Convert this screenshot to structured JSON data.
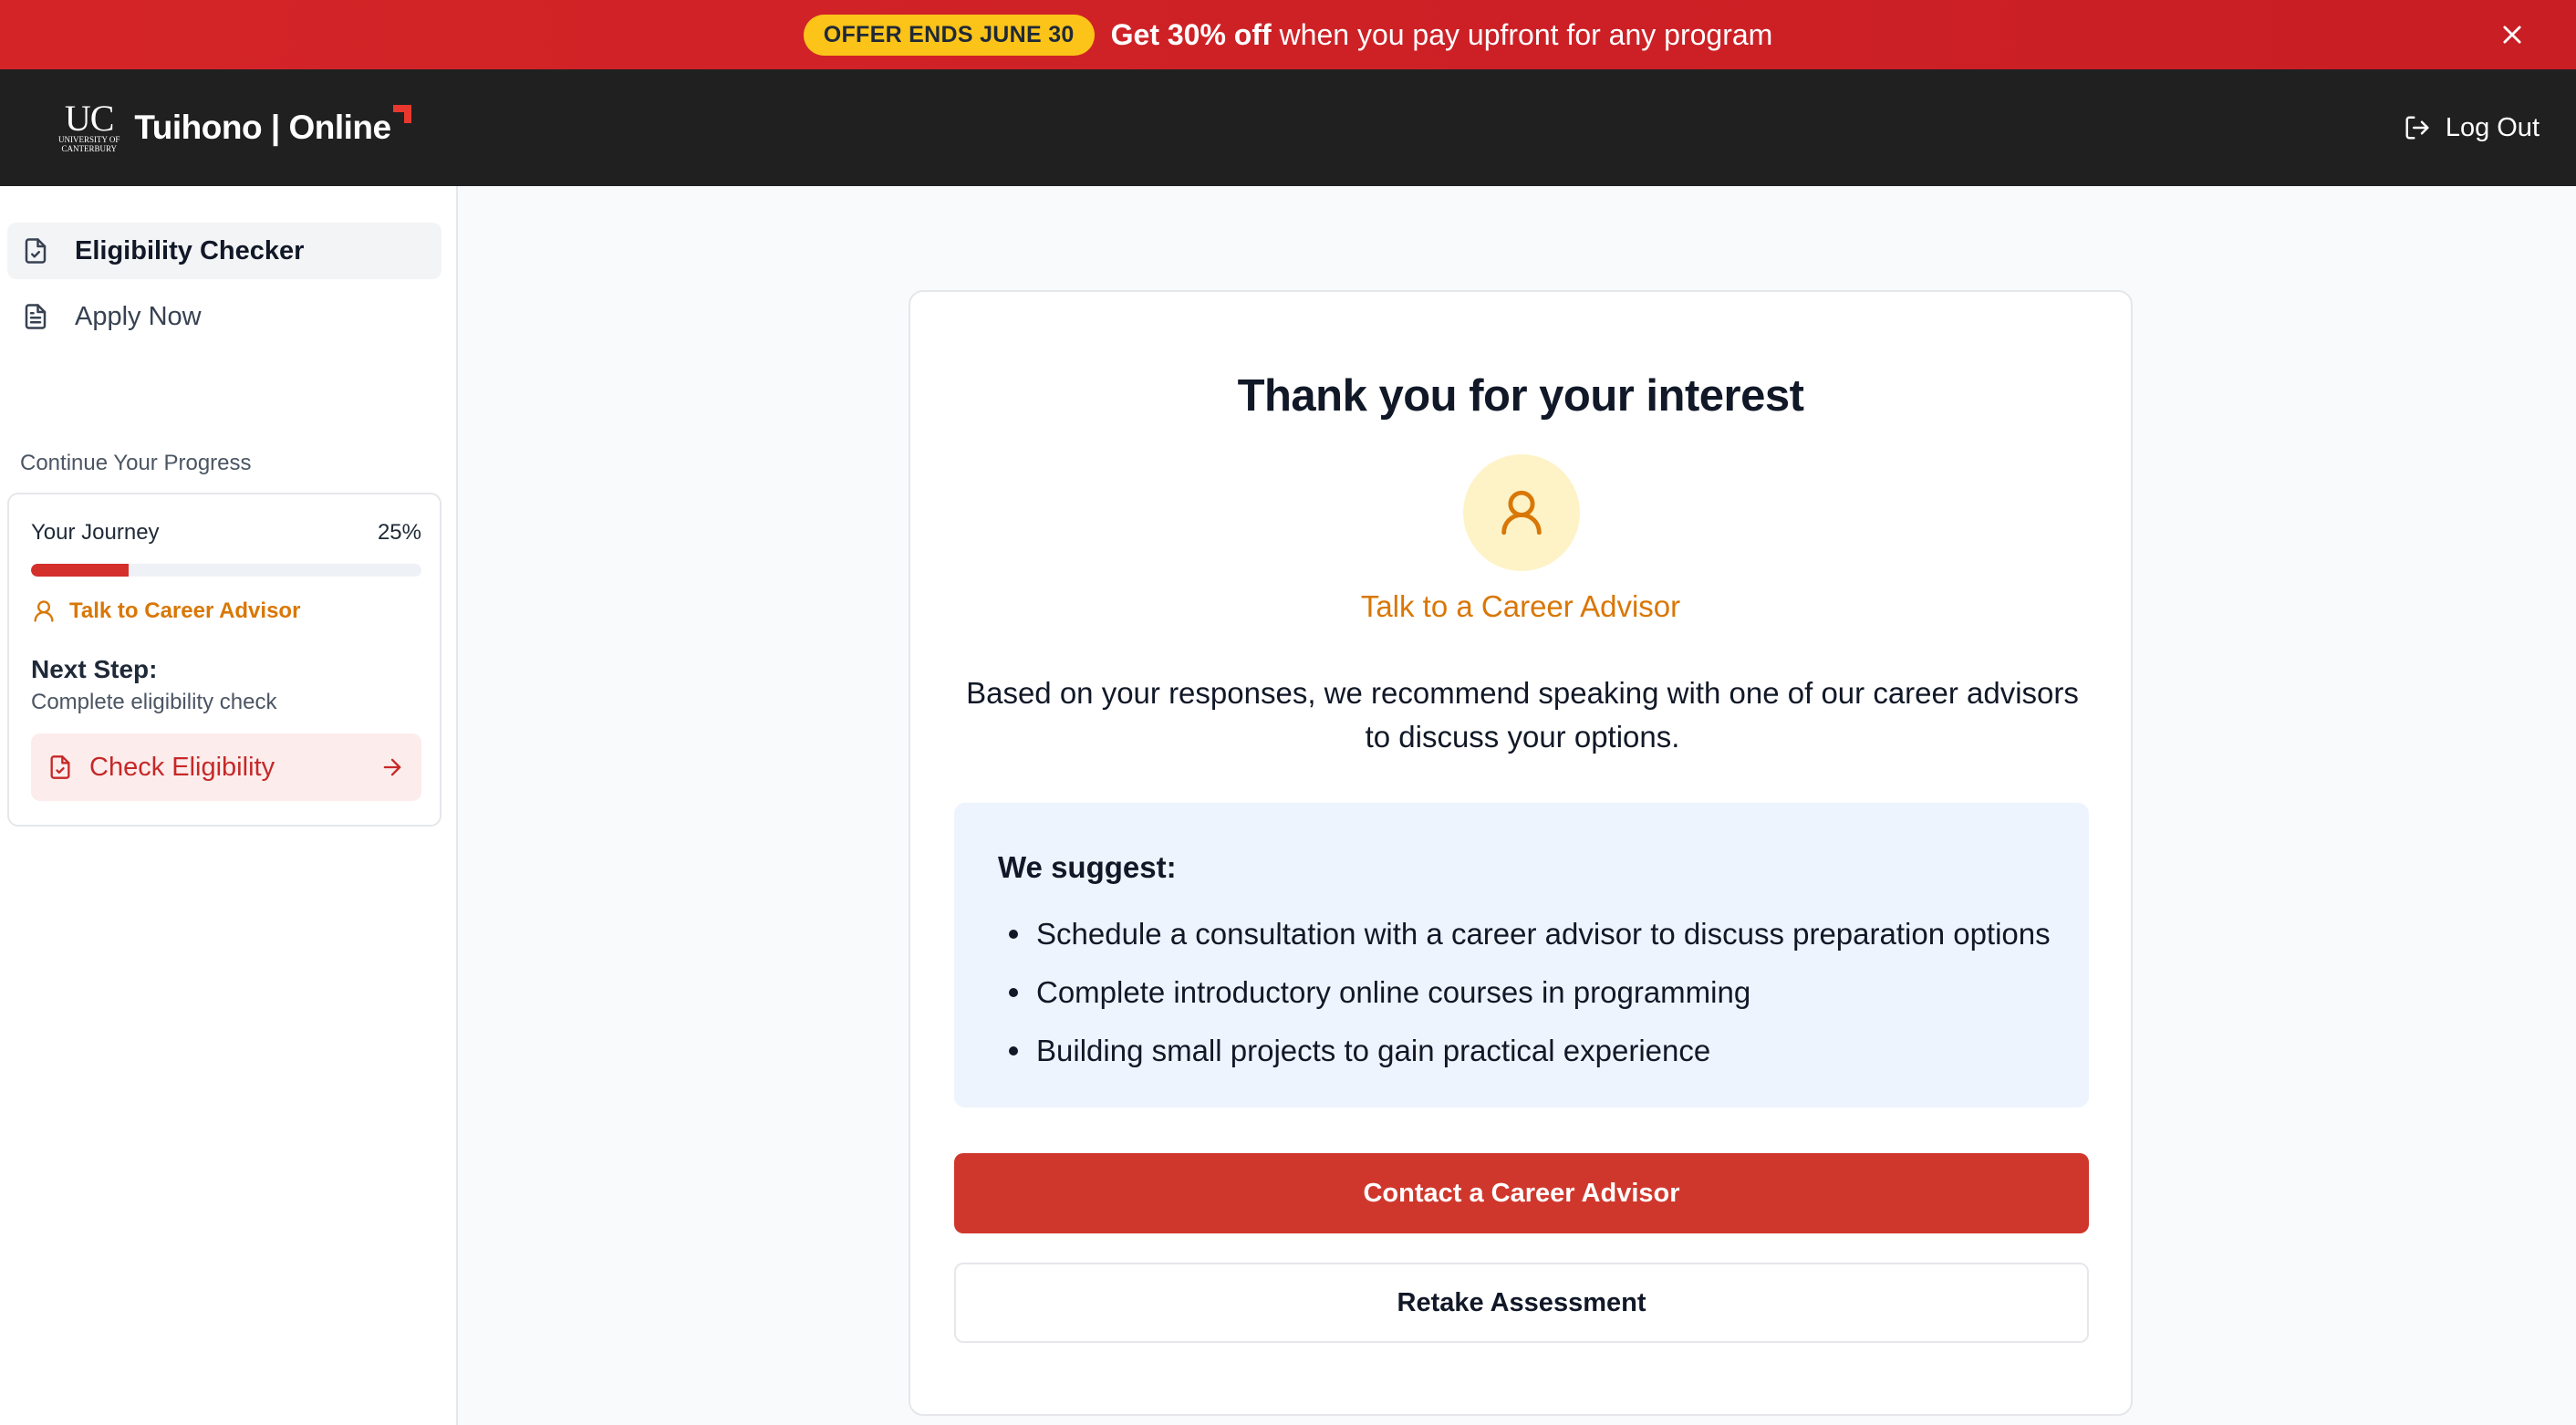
{
  "promo": {
    "badge": "OFFER ENDS JUNE 30",
    "highlight": "Get 30% off",
    "text": " when you pay upfront for any program",
    "close_icon": "close-icon"
  },
  "header": {
    "logo_uc": "UC",
    "logo_uc_sub1": "UNIVERSITY OF",
    "logo_uc_sub2": "CANTERBURY",
    "logo_text": "Tuihono | Online",
    "logout_label": "Log Out",
    "logout_icon": "logout-icon"
  },
  "sidebar": {
    "items": [
      {
        "label": "Eligibility Checker",
        "icon": "file-check-icon",
        "active": true
      },
      {
        "label": "Apply Now",
        "icon": "file-text-icon",
        "active": false
      }
    ],
    "progress_heading": "Continue Your Progress",
    "journey_label": "Your Journey",
    "journey_percent": "25%",
    "journey_progress": 0.25,
    "advisor_label": "Talk to Career Advisor",
    "next_step_title": "Next Step:",
    "next_step_desc": "Complete eligibility check",
    "check_button": "Check Eligibility"
  },
  "main": {
    "title": "Thank you for your interest",
    "advisor_label": "Talk to a Career Advisor",
    "description": "Based on your responses, we recommend speaking with one of our career advisors to discuss your options.",
    "suggest_title": "We suggest:",
    "suggestions": [
      "Schedule a consultation with a career advisor to discuss preparation options",
      "Complete introductory online courses in programming",
      "Building small projects to gain practical experience"
    ],
    "primary_button": "Contact a Career Advisor",
    "secondary_button": "Retake Assessment"
  },
  "colors": {
    "brand_red": "#d0372c",
    "advisor_amber": "#d97706",
    "badge_yellow": "#fcc419"
  }
}
